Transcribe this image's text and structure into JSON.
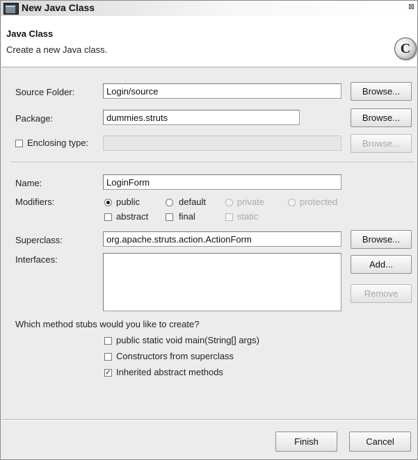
{
  "window": {
    "title": "New Java Class"
  },
  "header": {
    "title": "Java Class",
    "subtitle": "Create a new Java class.",
    "icon_letter": "C"
  },
  "form": {
    "source_folder": {
      "label": "Source Folder:",
      "value": "Login/source",
      "browse": "Browse..."
    },
    "package": {
      "label": "Package:",
      "value": "dummies.struts",
      "browse": "Browse..."
    },
    "enclosing_type": {
      "label": "Enclosing type:",
      "value": "",
      "checked": false,
      "browse": "Browse..."
    },
    "name": {
      "label": "Name:",
      "value": "LoginForm"
    },
    "modifiers": {
      "label": "Modifiers:",
      "access": [
        {
          "label": "public",
          "checked": true,
          "enabled": true
        },
        {
          "label": "default",
          "checked": false,
          "enabled": true
        },
        {
          "label": "private",
          "checked": false,
          "enabled": false
        },
        {
          "label": "protected",
          "checked": false,
          "enabled": false
        }
      ],
      "flags": [
        {
          "label": "abstract",
          "checked": false,
          "enabled": true
        },
        {
          "label": "final",
          "checked": false,
          "enabled": true
        },
        {
          "label": "static",
          "checked": false,
          "enabled": false
        }
      ]
    },
    "superclass": {
      "label": "Superclass:",
      "value": "org.apache.struts.action.ActionForm",
      "browse": "Browse..."
    },
    "interfaces": {
      "label": "Interfaces:",
      "add": "Add...",
      "remove": "Remove"
    },
    "stubs": {
      "question": "Which method stubs would you like to create?",
      "options": [
        {
          "label": "public static void main(String[] args)",
          "checked": false
        },
        {
          "label": "Constructors from superclass",
          "checked": false
        },
        {
          "label": "Inherited abstract methods",
          "checked": true
        }
      ]
    }
  },
  "footer": {
    "finish": "Finish",
    "cancel": "Cancel"
  },
  "icons": {
    "window": "java-class-window-icon",
    "close": "close-icon",
    "class": "class-c-icon"
  }
}
